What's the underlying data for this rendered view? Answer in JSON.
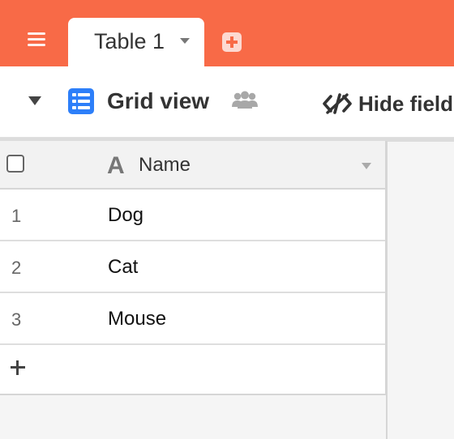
{
  "tabs": [
    {
      "label": "Table 1",
      "active": true
    }
  ],
  "view": {
    "name": "Grid view",
    "hide_fields_label": "Hide fields"
  },
  "table": {
    "columns": [
      {
        "type_icon": "A",
        "name": "Name"
      }
    ],
    "rows": [
      {
        "number": "1",
        "name": "Dog"
      },
      {
        "number": "2",
        "name": "Cat"
      },
      {
        "number": "3",
        "name": "Mouse"
      }
    ],
    "add_row_label": "+"
  },
  "colors": {
    "topbar": "#f86a47",
    "grid_icon": "#2d7ff9"
  }
}
